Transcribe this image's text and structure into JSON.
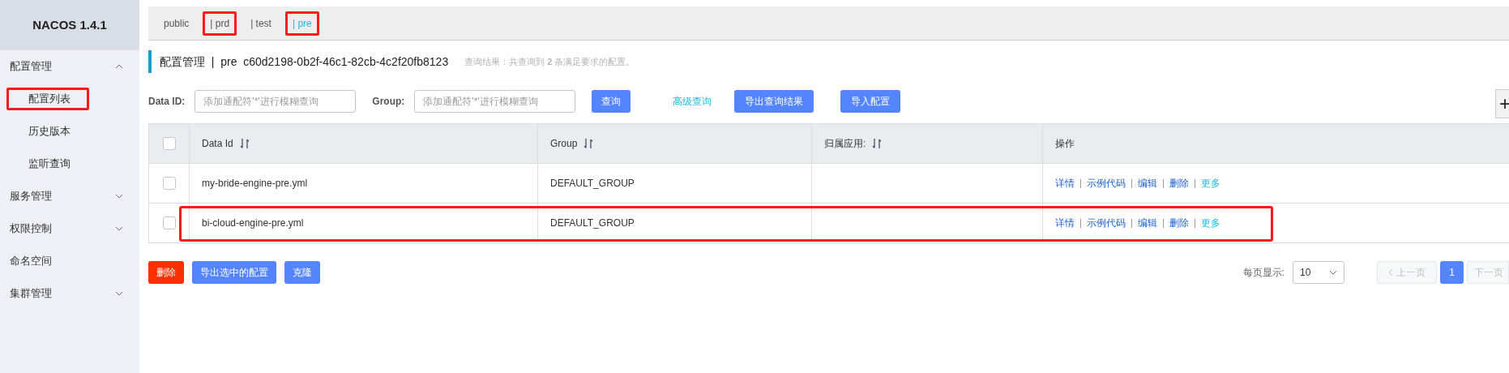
{
  "sidebar": {
    "title": "NACOS 1.4.1",
    "items": [
      {
        "kind": "group",
        "label": "配置管理",
        "expanded": true,
        "children": [
          {
            "label": "配置列表",
            "annotated": true
          },
          {
            "label": "历史版本",
            "annotated": false
          },
          {
            "label": "监听查询",
            "annotated": false
          }
        ]
      },
      {
        "kind": "group",
        "label": "服务管理",
        "expanded": false
      },
      {
        "kind": "group",
        "label": "权限控制",
        "expanded": false
      },
      {
        "kind": "link",
        "label": "命名空间"
      },
      {
        "kind": "group",
        "label": "集群管理",
        "expanded": false
      }
    ]
  },
  "namespaces": [
    {
      "label": "public",
      "selected": false,
      "annotated": false
    },
    {
      "label": "| prd",
      "selected": false,
      "annotated": true
    },
    {
      "label": "| test",
      "selected": false,
      "annotated": false
    },
    {
      "label": "| pre",
      "selected": true,
      "annotated": true
    }
  ],
  "heading": {
    "title": "配置管理  |  pre  c60d2198-0b2f-46c1-82cb-4c2f20fb8123",
    "summary": "查询结果：共查询到 **2** 条满足要求的配置。"
  },
  "search": {
    "fields": [
      {
        "label": "Data ID:",
        "placeholder": "添加通配符'*'进行模糊查询"
      },
      {
        "label": "Group:",
        "placeholder": "添加通配符'*'进行模糊查询"
      }
    ],
    "query_button": "查询",
    "advanced_link": "高级查询",
    "buttons": [
      "导出查询结果",
      "导入配置"
    ],
    "add_button": "+"
  },
  "table": {
    "all_checked": false,
    "columns": [
      {
        "label": "Data Id",
        "sortable": true
      },
      {
        "label": "Group",
        "sortable": true
      },
      {
        "label": "归属应用:",
        "sortable": true
      },
      {
        "label": "操作",
        "sortable": false
      }
    ],
    "rows": [
      {
        "checked": false,
        "annotated": false,
        "data_id": "my-bride-engine-pre.yml",
        "group": "DEFAULT_GROUP",
        "actions": [
          {
            "label": "详情",
            "kind": "action"
          },
          {
            "label": "示例代码",
            "kind": "action"
          },
          {
            "label": "编辑",
            "kind": "action"
          },
          {
            "label": "删除",
            "kind": "action"
          },
          {
            "label": "更多",
            "kind": "menu"
          }
        ]
      },
      {
        "checked": false,
        "annotated": true,
        "data_id": "bi-cloud-engine-pre.yml",
        "group": "DEFAULT_GROUP",
        "actions": [
          {
            "label": "详情",
            "kind": "action"
          },
          {
            "label": "示例代码",
            "kind": "action"
          },
          {
            "label": "编辑",
            "kind": "action"
          },
          {
            "label": "删除",
            "kind": "action"
          },
          {
            "label": "更多",
            "kind": "menu"
          }
        ]
      }
    ]
  },
  "bulk_actions": [
    {
      "label": "删除",
      "kind": "danger"
    },
    {
      "label": "导出选中的配置",
      "kind": "primary"
    },
    {
      "label": "克隆",
      "kind": "primary"
    }
  ],
  "pagination": {
    "page_size_label": "每页显示:",
    "page_size": "10",
    "prev": {
      "label": "上一页",
      "disabled": true
    },
    "pages": [
      {
        "label": "1",
        "selected": true
      }
    ],
    "next": {
      "label": "下一页",
      "disabled": true
    }
  }
}
